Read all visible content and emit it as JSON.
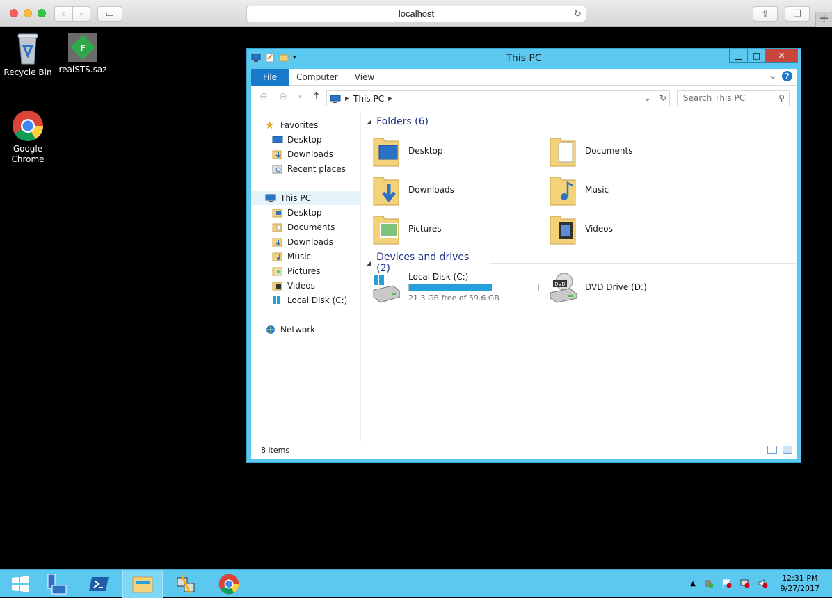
{
  "browser": {
    "url": "localhost"
  },
  "desktop_icons": [
    {
      "label": "Recycle Bin",
      "icon": "recycle-bin-icon"
    },
    {
      "label": "realSTS.saz",
      "icon": "fiddler-file-icon"
    },
    {
      "label": "Google Chrome",
      "icon": "chrome-icon"
    }
  ],
  "window": {
    "title": "This PC",
    "ribbon_tabs": [
      "File",
      "Computer",
      "View"
    ],
    "address_label": "This PC",
    "search_placeholder": "Search This PC",
    "nav": {
      "favorites": "Favorites",
      "fav_items": [
        "Desktop",
        "Downloads",
        "Recent places"
      ],
      "this_pc": "This PC",
      "pc_items": [
        "Desktop",
        "Documents",
        "Downloads",
        "Music",
        "Pictures",
        "Videos",
        "Local Disk (C:)"
      ],
      "network": "Network"
    },
    "folders_header": "Folders (6)",
    "folders": [
      "Desktop",
      "Documents",
      "Downloads",
      "Music",
      "Pictures",
      "Videos"
    ],
    "devices_header": "Devices and drives (2)",
    "drive_c": {
      "name": "Local Disk (C:)",
      "free_text": "21.3 GB free of 59.6 GB",
      "used_fraction": 0.64
    },
    "drive_d": {
      "name": "DVD Drive (D:)"
    },
    "status_items": "8 items"
  },
  "taskbar": {
    "clock_time": "12:31 PM",
    "clock_date": "9/27/2017"
  },
  "colors": {
    "win_frame": "#5bc8f0",
    "file_tab": "#1979ca",
    "group_header": "#1e3287",
    "drive_fill": "#26a0da"
  }
}
